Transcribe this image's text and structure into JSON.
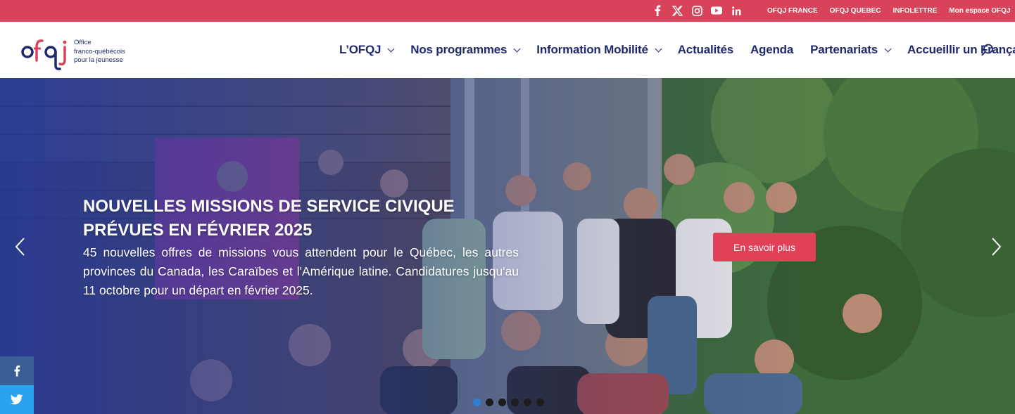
{
  "topbar": {
    "bg_color": "#d9435a",
    "social_icons": [
      "facebook-icon",
      "x-twitter-icon",
      "instagram-icon",
      "youtube-icon",
      "linkedin-icon"
    ],
    "links": [
      "OFQJ FRANCE",
      "OFQJ QUEBEC",
      "INFOLETTRE",
      "Mon espace OFQJ"
    ]
  },
  "header": {
    "logo_lines": [
      "Office",
      "franco-québécois",
      "pour la jeunesse"
    ],
    "nav": [
      {
        "label": "L’OFQJ",
        "dropdown": true
      },
      {
        "label": "Nos programmes",
        "dropdown": true
      },
      {
        "label": "Information Mobilité",
        "dropdown": true
      },
      {
        "label": "Actualités",
        "dropdown": false
      },
      {
        "label": "Agenda",
        "dropdown": false
      },
      {
        "label": "Partenariats",
        "dropdown": true
      },
      {
        "label": "Accueillir un Français",
        "dropdown": true
      }
    ],
    "brand_color": "#1f2a6e",
    "accent_color": "#e04157"
  },
  "hero": {
    "title_line1": "NOUVELLES MISSIONS DE SERVICE CIVIQUE",
    "title_line2": "PRÉVUES EN FÉVRIER 2025",
    "text": "45 nouvelles offres de missions vous attendent pour le Québec, les autres provinces du Canada, les Caraïbes et l'Amérique latine. Candidatures jusqu'au 11 octobre pour un départ en février 2025.",
    "cta": "En savoir plus",
    "slide_count": 6,
    "active_slide": 1
  },
  "share": {
    "facebook_glyph": "f",
    "twitter_glyph": "🐦"
  }
}
